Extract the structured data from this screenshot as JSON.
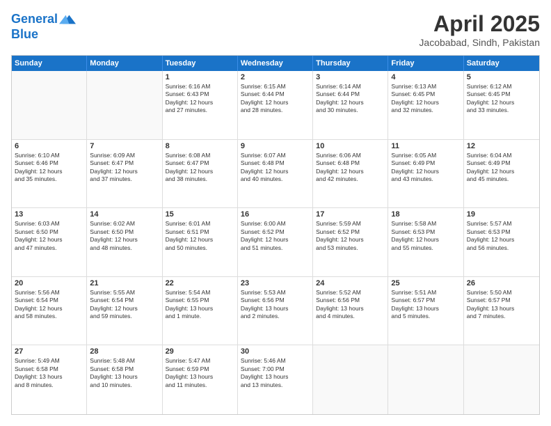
{
  "header": {
    "logo_line1": "General",
    "logo_line2": "Blue",
    "month_year": "April 2025",
    "location": "Jacobabad, Sindh, Pakistan"
  },
  "days_of_week": [
    "Sunday",
    "Monday",
    "Tuesday",
    "Wednesday",
    "Thursday",
    "Friday",
    "Saturday"
  ],
  "weeks": [
    [
      {
        "day": "",
        "text": ""
      },
      {
        "day": "",
        "text": ""
      },
      {
        "day": "1",
        "text": "Sunrise: 6:16 AM\nSunset: 6:43 PM\nDaylight: 12 hours\nand 27 minutes."
      },
      {
        "day": "2",
        "text": "Sunrise: 6:15 AM\nSunset: 6:44 PM\nDaylight: 12 hours\nand 28 minutes."
      },
      {
        "day": "3",
        "text": "Sunrise: 6:14 AM\nSunset: 6:44 PM\nDaylight: 12 hours\nand 30 minutes."
      },
      {
        "day": "4",
        "text": "Sunrise: 6:13 AM\nSunset: 6:45 PM\nDaylight: 12 hours\nand 32 minutes."
      },
      {
        "day": "5",
        "text": "Sunrise: 6:12 AM\nSunset: 6:45 PM\nDaylight: 12 hours\nand 33 minutes."
      }
    ],
    [
      {
        "day": "6",
        "text": "Sunrise: 6:10 AM\nSunset: 6:46 PM\nDaylight: 12 hours\nand 35 minutes."
      },
      {
        "day": "7",
        "text": "Sunrise: 6:09 AM\nSunset: 6:47 PM\nDaylight: 12 hours\nand 37 minutes."
      },
      {
        "day": "8",
        "text": "Sunrise: 6:08 AM\nSunset: 6:47 PM\nDaylight: 12 hours\nand 38 minutes."
      },
      {
        "day": "9",
        "text": "Sunrise: 6:07 AM\nSunset: 6:48 PM\nDaylight: 12 hours\nand 40 minutes."
      },
      {
        "day": "10",
        "text": "Sunrise: 6:06 AM\nSunset: 6:48 PM\nDaylight: 12 hours\nand 42 minutes."
      },
      {
        "day": "11",
        "text": "Sunrise: 6:05 AM\nSunset: 6:49 PM\nDaylight: 12 hours\nand 43 minutes."
      },
      {
        "day": "12",
        "text": "Sunrise: 6:04 AM\nSunset: 6:49 PM\nDaylight: 12 hours\nand 45 minutes."
      }
    ],
    [
      {
        "day": "13",
        "text": "Sunrise: 6:03 AM\nSunset: 6:50 PM\nDaylight: 12 hours\nand 47 minutes."
      },
      {
        "day": "14",
        "text": "Sunrise: 6:02 AM\nSunset: 6:50 PM\nDaylight: 12 hours\nand 48 minutes."
      },
      {
        "day": "15",
        "text": "Sunrise: 6:01 AM\nSunset: 6:51 PM\nDaylight: 12 hours\nand 50 minutes."
      },
      {
        "day": "16",
        "text": "Sunrise: 6:00 AM\nSunset: 6:52 PM\nDaylight: 12 hours\nand 51 minutes."
      },
      {
        "day": "17",
        "text": "Sunrise: 5:59 AM\nSunset: 6:52 PM\nDaylight: 12 hours\nand 53 minutes."
      },
      {
        "day": "18",
        "text": "Sunrise: 5:58 AM\nSunset: 6:53 PM\nDaylight: 12 hours\nand 55 minutes."
      },
      {
        "day": "19",
        "text": "Sunrise: 5:57 AM\nSunset: 6:53 PM\nDaylight: 12 hours\nand 56 minutes."
      }
    ],
    [
      {
        "day": "20",
        "text": "Sunrise: 5:56 AM\nSunset: 6:54 PM\nDaylight: 12 hours\nand 58 minutes."
      },
      {
        "day": "21",
        "text": "Sunrise: 5:55 AM\nSunset: 6:54 PM\nDaylight: 12 hours\nand 59 minutes."
      },
      {
        "day": "22",
        "text": "Sunrise: 5:54 AM\nSunset: 6:55 PM\nDaylight: 13 hours\nand 1 minute."
      },
      {
        "day": "23",
        "text": "Sunrise: 5:53 AM\nSunset: 6:56 PM\nDaylight: 13 hours\nand 2 minutes."
      },
      {
        "day": "24",
        "text": "Sunrise: 5:52 AM\nSunset: 6:56 PM\nDaylight: 13 hours\nand 4 minutes."
      },
      {
        "day": "25",
        "text": "Sunrise: 5:51 AM\nSunset: 6:57 PM\nDaylight: 13 hours\nand 5 minutes."
      },
      {
        "day": "26",
        "text": "Sunrise: 5:50 AM\nSunset: 6:57 PM\nDaylight: 13 hours\nand 7 minutes."
      }
    ],
    [
      {
        "day": "27",
        "text": "Sunrise: 5:49 AM\nSunset: 6:58 PM\nDaylight: 13 hours\nand 8 minutes."
      },
      {
        "day": "28",
        "text": "Sunrise: 5:48 AM\nSunset: 6:58 PM\nDaylight: 13 hours\nand 10 minutes."
      },
      {
        "day": "29",
        "text": "Sunrise: 5:47 AM\nSunset: 6:59 PM\nDaylight: 13 hours\nand 11 minutes."
      },
      {
        "day": "30",
        "text": "Sunrise: 5:46 AM\nSunset: 7:00 PM\nDaylight: 13 hours\nand 13 minutes."
      },
      {
        "day": "",
        "text": ""
      },
      {
        "day": "",
        "text": ""
      },
      {
        "day": "",
        "text": ""
      }
    ]
  ]
}
